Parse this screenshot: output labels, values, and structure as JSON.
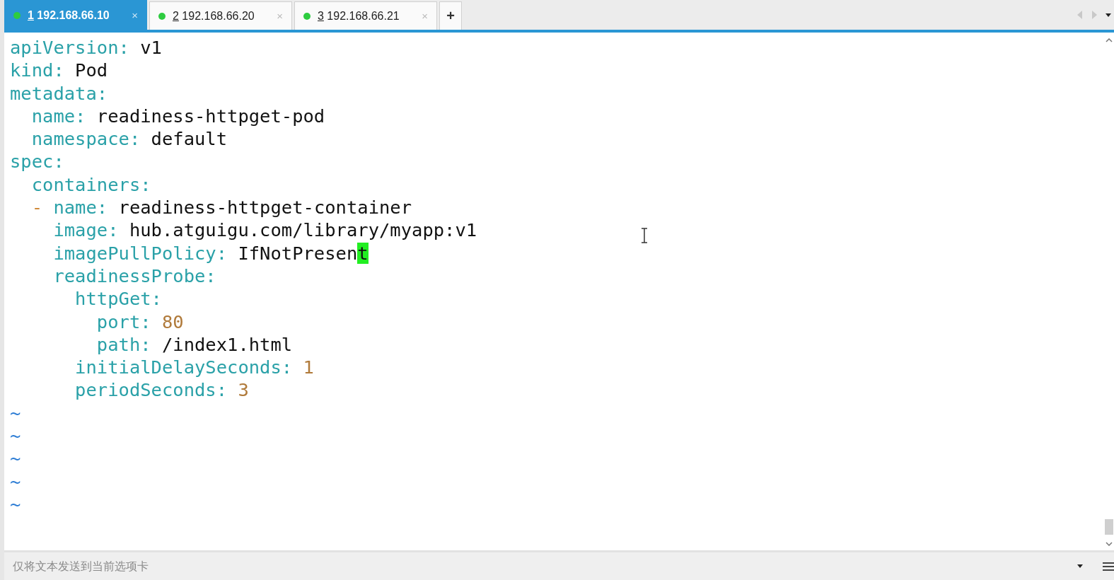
{
  "tabs": [
    {
      "number": "1",
      "host": "192.168.66.10",
      "selected": true,
      "close": "×"
    },
    {
      "number": "2",
      "host": "192.168.66.20",
      "selected": false,
      "close": "×"
    },
    {
      "number": "3",
      "host": "192.168.66.21",
      "selected": false,
      "close": "×"
    }
  ],
  "new_tab": "+",
  "editor": {
    "lines": [
      [
        {
          "kind": "key",
          "text": "apiVersion:"
        },
        {
          "kind": "plain",
          "text": " v1"
        }
      ],
      [
        {
          "kind": "key",
          "text": "kind:"
        },
        {
          "kind": "plain",
          "text": " Pod"
        }
      ],
      [
        {
          "kind": "key",
          "text": "metadata:"
        }
      ],
      [
        {
          "kind": "key",
          "text": "  name:"
        },
        {
          "kind": "plain",
          "text": " readiness-httpget-pod"
        }
      ],
      [
        {
          "kind": "key",
          "text": "  namespace:"
        },
        {
          "kind": "plain",
          "text": " default"
        }
      ],
      [
        {
          "kind": "key",
          "text": "spec:"
        }
      ],
      [
        {
          "kind": "key",
          "text": "  containers:"
        }
      ],
      [
        {
          "kind": "dash",
          "text": "  -"
        },
        {
          "kind": "key",
          "text": " name:"
        },
        {
          "kind": "plain",
          "text": " readiness-httpget-container"
        }
      ],
      [
        {
          "kind": "key",
          "text": "    image:"
        },
        {
          "kind": "plain",
          "text": " hub.atguigu.com/library/myapp:v1"
        }
      ],
      [
        {
          "kind": "key",
          "text": "    imagePullPolicy:"
        },
        {
          "kind": "plain",
          "text": " IfNotPresen"
        },
        {
          "kind": "cursor",
          "text": "t"
        }
      ],
      [
        {
          "kind": "key",
          "text": "    readinessProbe:"
        }
      ],
      [
        {
          "kind": "key",
          "text": "      httpGet:"
        }
      ],
      [
        {
          "kind": "key",
          "text": "        port:"
        },
        {
          "kind": "number",
          "text": " 80"
        }
      ],
      [
        {
          "kind": "key",
          "text": "        path:"
        },
        {
          "kind": "plain",
          "text": " /index1.html"
        }
      ],
      [
        {
          "kind": "key",
          "text": "      initialDelaySeconds:"
        },
        {
          "kind": "number",
          "text": " 1"
        }
      ],
      [
        {
          "kind": "key",
          "text": "      periodSeconds:"
        },
        {
          "kind": "number",
          "text": " 3"
        }
      ],
      [
        {
          "kind": "tilde",
          "text": "~"
        }
      ],
      [
        {
          "kind": "tilde",
          "text": "~"
        }
      ],
      [
        {
          "kind": "tilde",
          "text": "~"
        }
      ],
      [
        {
          "kind": "tilde",
          "text": "~"
        }
      ],
      [
        {
          "kind": "tilde",
          "text": "~"
        }
      ]
    ]
  },
  "send_bar": {
    "placeholder": "仅将文本发送到当前选项卡"
  }
}
